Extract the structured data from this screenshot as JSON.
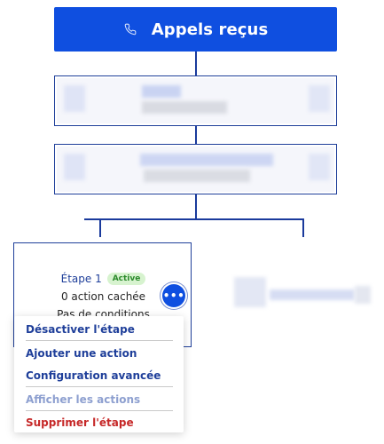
{
  "trigger": {
    "title": "Appels reçus",
    "icon": "phone-icon"
  },
  "step": {
    "title": "Étape 1",
    "badge": "Active",
    "hidden_actions": "0 action cachée",
    "conditions": "Pas de conditions"
  },
  "menu": {
    "items": [
      {
        "label": "Désactiver l'étape",
        "state": "normal"
      },
      {
        "label": "Ajouter une action",
        "state": "normal"
      },
      {
        "label": "Configuration avancée",
        "state": "normal"
      },
      {
        "label": "Afficher les actions",
        "state": "disabled"
      },
      {
        "label": "Supprimer l'étape",
        "state": "danger"
      }
    ]
  },
  "more_button": {
    "icon": "more-horizontal-icon",
    "glyph": "•••"
  },
  "colors": {
    "primary": "#0f4fe0",
    "connector": "#1a3a9c",
    "active_badge_bg": "#d7f3cf",
    "active_badge_text": "#2b8a2b",
    "danger": "#c62828",
    "disabled": "#8ea0d0"
  }
}
